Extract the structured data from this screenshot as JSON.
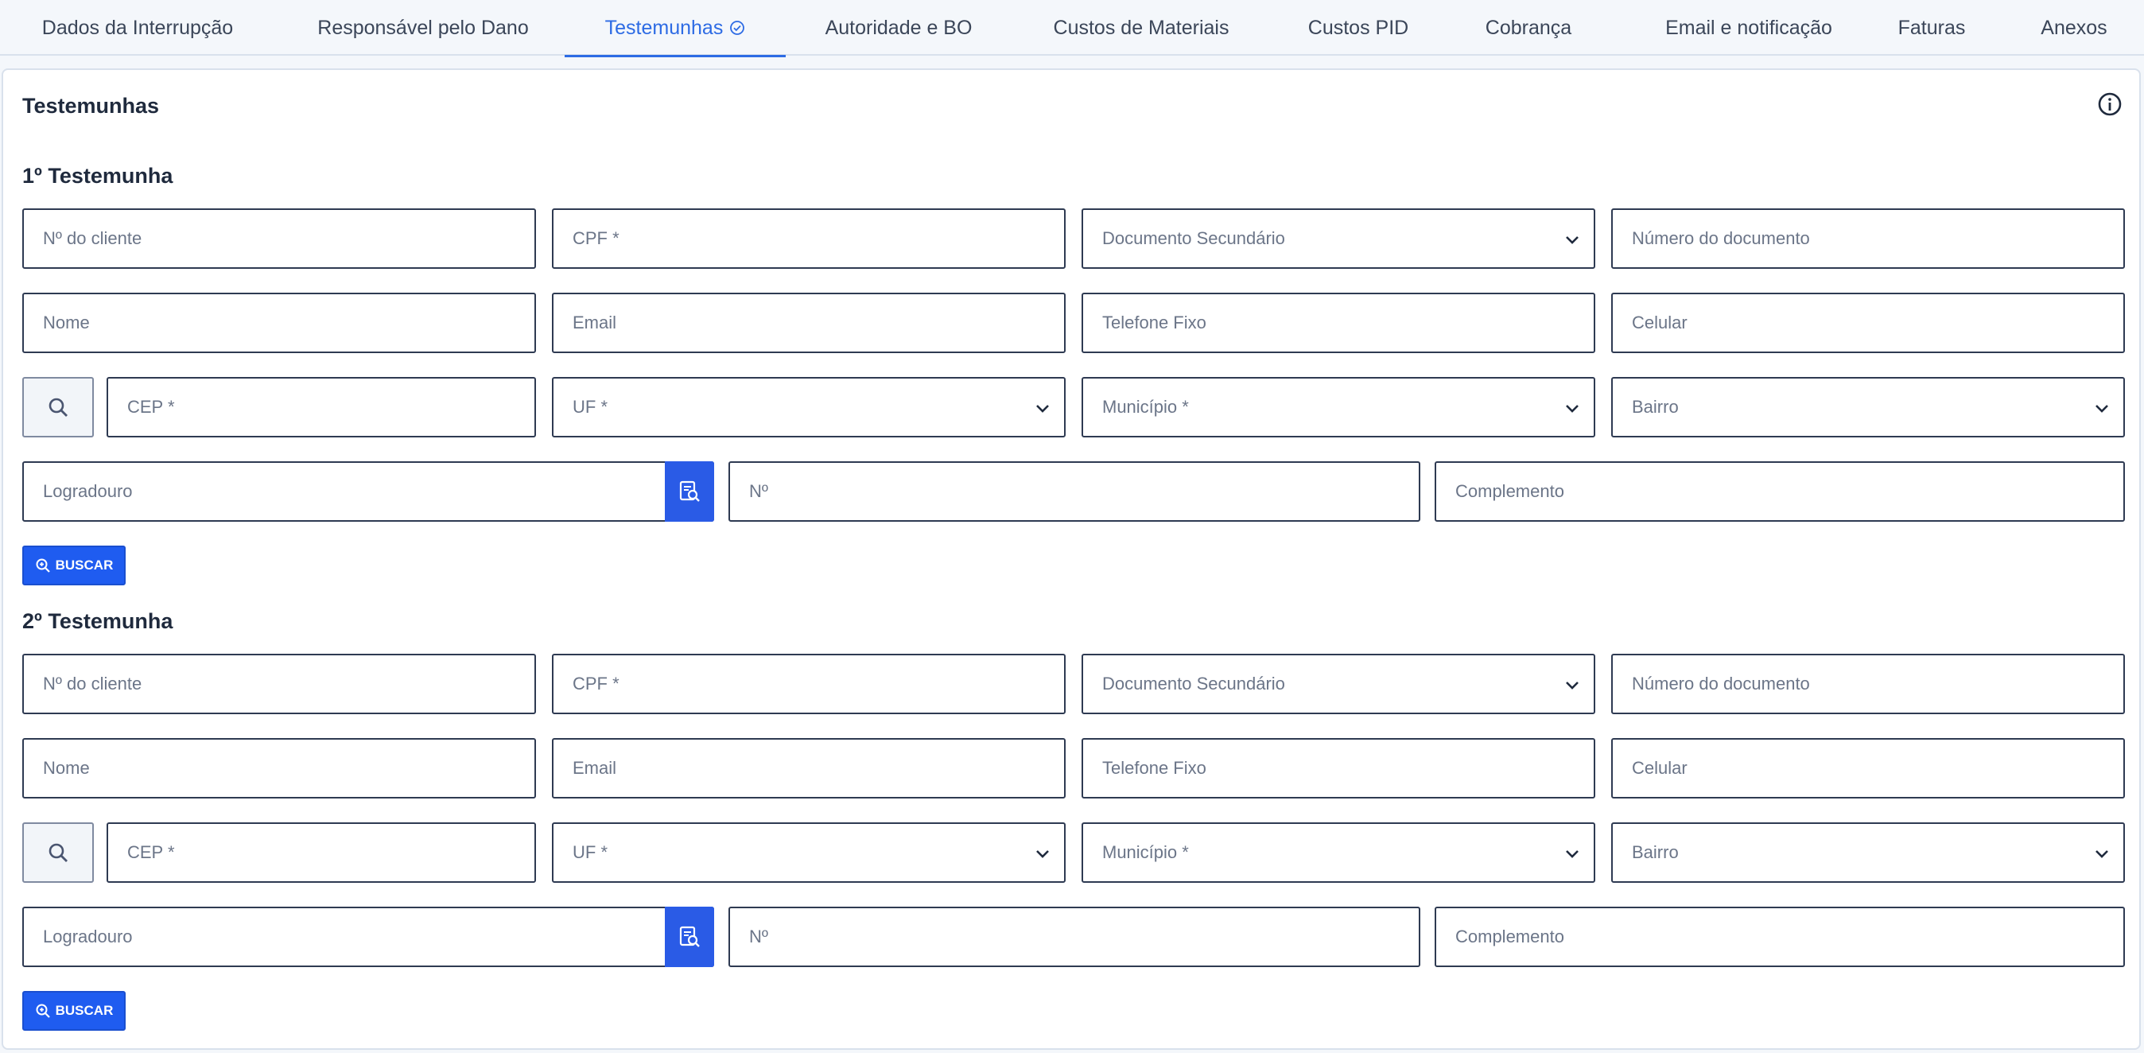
{
  "tabs": [
    {
      "label": "Dados da Interrupção"
    },
    {
      "label": "Responsável pelo Dano"
    },
    {
      "label": "Testemunhas"
    },
    {
      "label": "Autoridade e BO"
    },
    {
      "label": "Custos de Materiais"
    },
    {
      "label": "Custos PID"
    },
    {
      "label": "Cobrança"
    },
    {
      "label": "Email e notificação"
    },
    {
      "label": "Faturas"
    },
    {
      "label": "Anexos"
    }
  ],
  "active_tab_index": 2,
  "card": {
    "title": "Testemunhas"
  },
  "witness1": {
    "title": "1º Testemunha",
    "client_no": "Nº do cliente",
    "cpf": "CPF *",
    "secondary_doc": "Documento Secundário",
    "doc_number": "Número do documento",
    "name": "Nome",
    "email": "Email",
    "landline": "Telefone Fixo",
    "mobile": "Celular",
    "cep": "CEP *",
    "uf": "UF *",
    "municipio": "Município *",
    "bairro": "Bairro",
    "logradouro": "Logradouro",
    "number": "Nº",
    "complemento": "Complemento",
    "search_button": "BUSCAR"
  },
  "witness2": {
    "title": "2º Testemunha",
    "client_no": "Nº do cliente",
    "cpf": "CPF *",
    "secondary_doc": "Documento Secundário",
    "doc_number": "Número do documento",
    "name": "Nome",
    "email": "Email",
    "landline": "Telefone Fixo",
    "mobile": "Celular",
    "cep": "CEP *",
    "uf": "UF *",
    "municipio": "Município *",
    "bairro": "Bairro",
    "logradouro": "Logradouro",
    "number": "Nº",
    "complemento": "Complemento",
    "search_button": "BUSCAR"
  },
  "icons": {
    "tab_check": "check-circle-icon",
    "info": "info-icon",
    "cep_search": "search-icon",
    "logradouro_search": "document-search-icon",
    "buscar": "zoom-in-icon",
    "select": "chevron-down-icon"
  },
  "colors": {
    "accent": "#2d6be4",
    "button": "#1f5cf0",
    "field_border": "#2e3a52"
  }
}
